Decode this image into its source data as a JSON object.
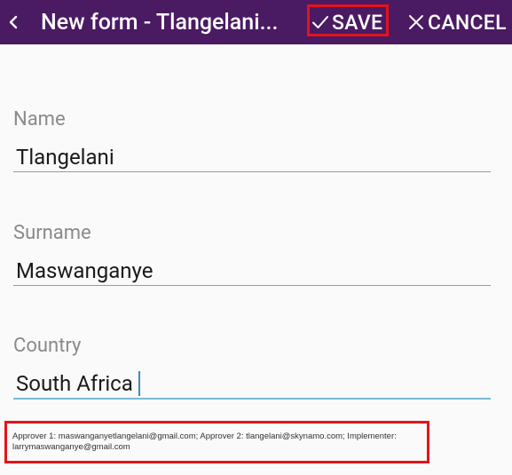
{
  "appbar": {
    "title": "New form - Tlangelani...",
    "save_label": "SAVE",
    "cancel_label": "CANCEL",
    "background": "#4a1a63",
    "highlight_color": "#e3131b"
  },
  "icons": {
    "back": "chevron-left-icon",
    "save": "check-icon",
    "cancel": "close-icon"
  },
  "form": {
    "fields": [
      {
        "label": "Name",
        "value": "Tlangelani"
      },
      {
        "label": "Surname",
        "value": "Maswanganye"
      },
      {
        "label": "Country",
        "value": "South Africa"
      }
    ]
  },
  "info": {
    "text": "Approver 1: maswanganyetlangelani@gmail.com; Approver 2: tlangelani@skynamo.com; Implementer: larrymaswanganye@gmail.com"
  }
}
